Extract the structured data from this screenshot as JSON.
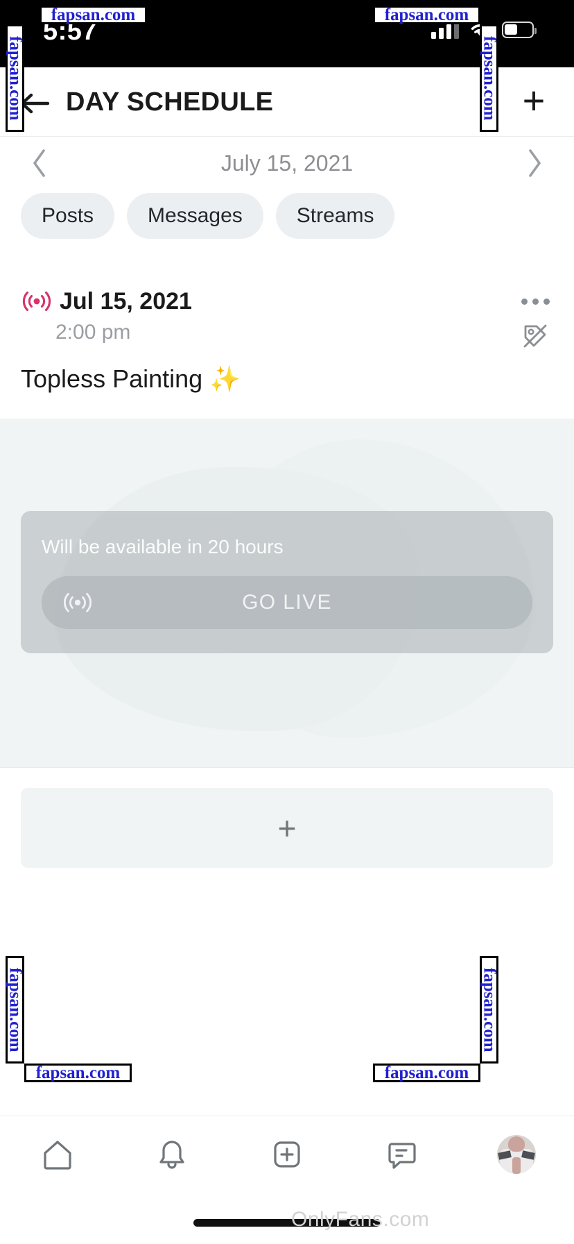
{
  "status_bar": {
    "time": "5:57",
    "signal_icon": "cellular-signal-icon",
    "wifi_icon": "wifi-icon",
    "battery_icon": "battery-icon"
  },
  "header": {
    "back_icon": "back-arrow-icon",
    "title": "DAY SCHEDULE",
    "add_label": "+",
    "add_icon": "plus-icon"
  },
  "date_nav": {
    "prev_icon": "chevron-left-icon",
    "label": "July 15, 2021",
    "next_icon": "chevron-right-icon"
  },
  "tabs": [
    {
      "label": "Posts",
      "name": "tab-posts"
    },
    {
      "label": "Messages",
      "name": "tab-messages"
    },
    {
      "label": "Streams",
      "name": "tab-streams"
    }
  ],
  "event": {
    "live_icon": "broadcast-icon",
    "date": "Jul 15, 2021",
    "time": "2:00 pm",
    "title": "Topless Painting ",
    "title_emoji": "✨",
    "more_icon": "more-options-icon",
    "price_off_icon": "tag-disabled-icon",
    "overlay": {
      "availability": "Will be available in 20 hours",
      "go_live_label": "GO LIVE",
      "go_live_icon": "broadcast-icon"
    }
  },
  "add_media": {
    "plus_label": "+",
    "icon": "plus-icon"
  },
  "bottom_nav": [
    {
      "name": "nav-home",
      "icon": "home-icon"
    },
    {
      "name": "nav-notifications",
      "icon": "bell-icon"
    },
    {
      "name": "nav-add",
      "icon": "add-square-icon"
    },
    {
      "name": "nav-messages",
      "icon": "chat-icon"
    },
    {
      "name": "nav-profile",
      "icon": "avatar-icon"
    }
  ],
  "watermarks": {
    "site": "fapsan.com",
    "brand": "OnlyFans.com"
  },
  "colors": {
    "live_accent": "#d6336c",
    "tab_bg": "#eceff1",
    "muted_text": "#8e8e93",
    "watermark_blue": "#2020d0"
  }
}
